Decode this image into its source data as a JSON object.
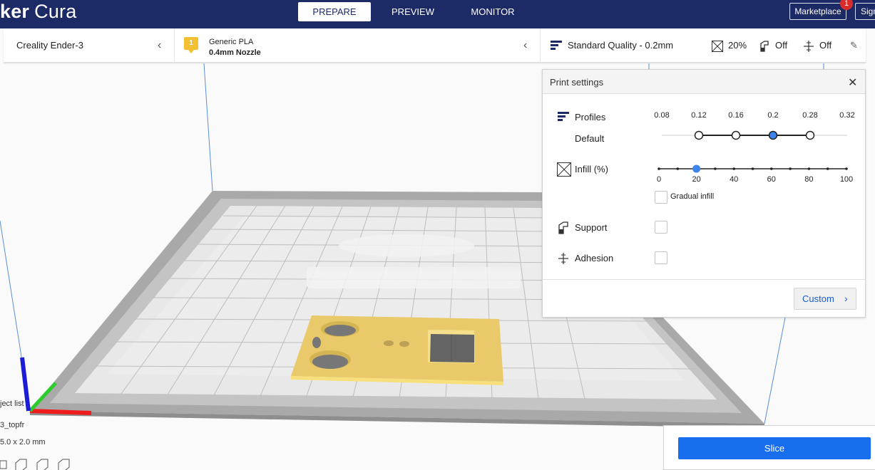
{
  "app": {
    "brand_part1": "ker",
    "brand_part2": "Cura"
  },
  "header": {
    "tabs": [
      {
        "label": "PREPARE",
        "active": true
      },
      {
        "label": "PREVIEW",
        "active": false
      },
      {
        "label": "MONITOR",
        "active": false
      }
    ],
    "marketplace_label": "Marketplace",
    "marketplace_badge": "1",
    "sign_in_label": "Sign"
  },
  "printer_bar": {
    "printer": "Creality Ender-3",
    "material": {
      "icon_number": "1",
      "name": "Generic PLA",
      "nozzle": "0.4mm Nozzle"
    },
    "quality": {
      "profile": "Standard Quality - 0.2mm",
      "infill": "20%",
      "support": "Off",
      "adhesion": "Off"
    }
  },
  "print_settings": {
    "title": "Print settings",
    "profiles": {
      "label": "Profiles",
      "sub_label": "Default",
      "ticks": [
        "0.08",
        "0.12",
        "0.16",
        "0.2",
        "0.28",
        "0.32"
      ],
      "available": [
        "0.12",
        "0.16",
        "0.2",
        "0.28"
      ],
      "selected": "0.2"
    },
    "infill": {
      "label": "Infill (%)",
      "ticks": [
        "0",
        "20",
        "40",
        "60",
        "80",
        "100"
      ],
      "value": 20,
      "gradual_label": "Gradual infill",
      "gradual_checked": false
    },
    "support": {
      "label": "Support",
      "checked": false
    },
    "adhesion": {
      "label": "Adhesion",
      "checked": false
    },
    "custom_label": "Custom"
  },
  "object_list": {
    "title": "ject list",
    "object_name": "3_topfr",
    "dimensions": "5.0 x 2.0 mm"
  },
  "slice": {
    "label": "Slice"
  },
  "colors": {
    "header": "#1c2a66",
    "accent": "#196ef0",
    "model": "#e9c96a",
    "bed_border": "#9e9e9e"
  }
}
